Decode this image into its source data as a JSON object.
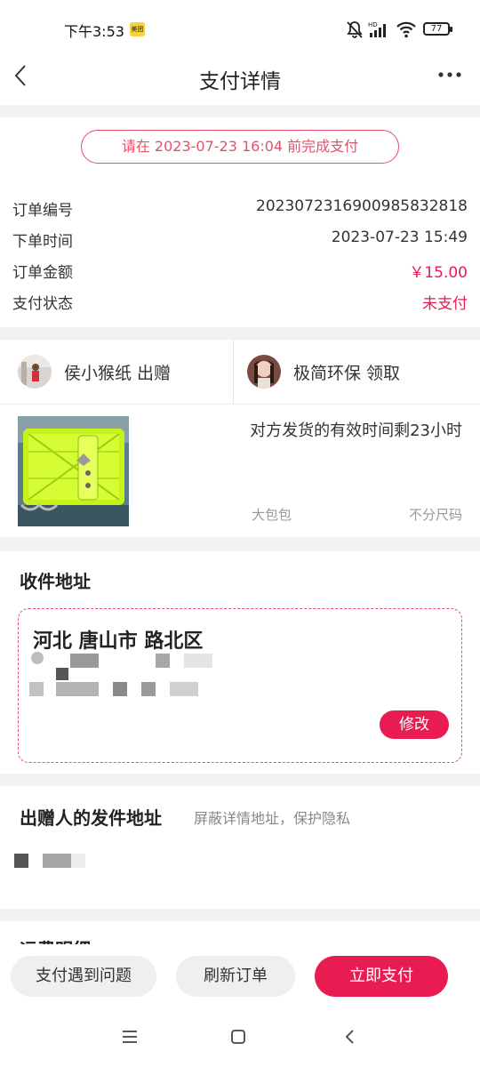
{
  "status_bar": {
    "time": "下午3:53",
    "app_badge": "美团",
    "battery": "77"
  },
  "header": {
    "title": "支付详情"
  },
  "payment": {
    "deadline": "请在 2023-07-23 16:04 前完成支付",
    "rows": [
      {
        "label": "订单编号",
        "value": "20230723169009858328​18"
      },
      {
        "label": "下单时间",
        "value": "2023-07-23 15:49"
      },
      {
        "label": "订单金额",
        "value": "￥15.00"
      },
      {
        "label": "支付状态",
        "value": "未支付"
      }
    ]
  },
  "parties": {
    "giver": "侯小猴纸 出赠",
    "receiver": "极简环保 领取"
  },
  "item": {
    "shipping_hint": "对方发货的有效时间剩23小时",
    "category": "大包包",
    "size": "不分尺码"
  },
  "receive_address": {
    "title": "收件地址",
    "region": "河北 唐山市 路北区",
    "edit_label": "修改"
  },
  "sender_address": {
    "title": "出赠人的发件地址",
    "privacy_note": "屏蔽详情地址，保护隐私"
  },
  "fee_section": {
    "title": "运费明细"
  },
  "footer": {
    "problem_label": "支付遇到问题",
    "refresh_label": "刷新订单",
    "pay_label": "立即支付"
  },
  "colors": {
    "accent": "#e91c52",
    "accent_text": "#e5506a"
  }
}
